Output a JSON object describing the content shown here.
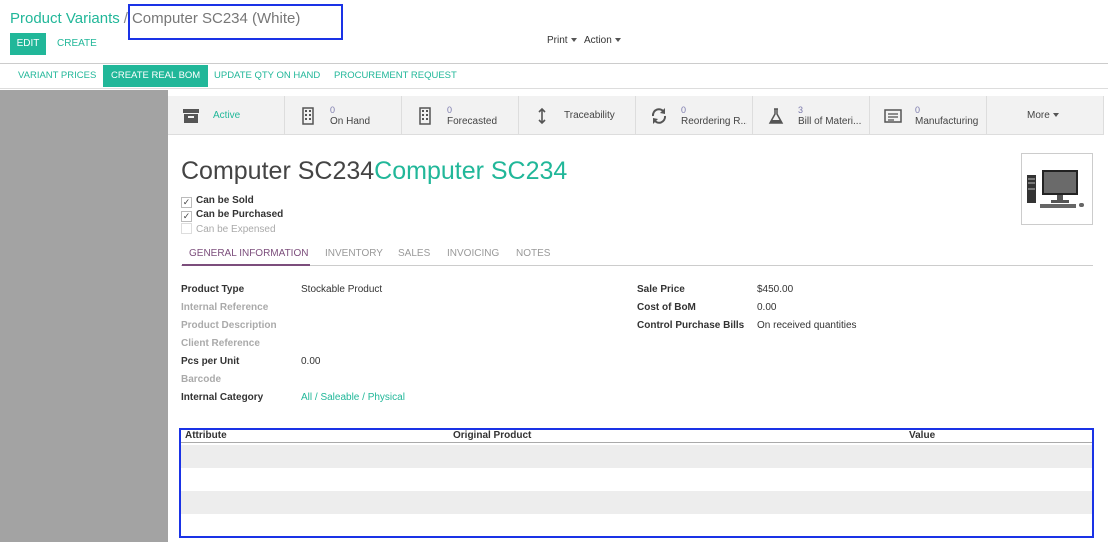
{
  "breadcrumb": {
    "parent": "Product Variants",
    "separator": "/",
    "current": "Computer SC234 (White)"
  },
  "controls": {
    "edit": "EDIT",
    "create": "CREATE",
    "print": "Print",
    "action": "Action"
  },
  "statusbar": {
    "variant_prices": "VARIANT PRICES",
    "create_real_bom": "CREATE REAL BOM",
    "update_qty": "UPDATE QTY ON HAND",
    "procurement": "PROCUREMENT REQUEST"
  },
  "smart_buttons": [
    {
      "icon": "archive-icon",
      "number": "",
      "label": "Active"
    },
    {
      "icon": "building-icon",
      "number": "0",
      "label": "On Hand"
    },
    {
      "icon": "building-icon",
      "number": "0",
      "label": "Forecasted"
    },
    {
      "icon": "arrows-vertical-icon",
      "number": "",
      "label": "Traceability"
    },
    {
      "icon": "refresh-icon",
      "number": "0",
      "label": "Reordering R..."
    },
    {
      "icon": "flask-icon",
      "number": "3",
      "label": "Bill of Materi..."
    },
    {
      "icon": "list-icon",
      "number": "0",
      "label": "Manufacturing"
    },
    {
      "icon": "",
      "number": "",
      "label": "More"
    }
  ],
  "product": {
    "name": "Computer SC234",
    "variant_name": "Computer SC234"
  },
  "checkboxes": [
    {
      "label": "Can be Sold",
      "checked": true
    },
    {
      "label": "Can be Purchased",
      "checked": true
    },
    {
      "label": "Can be Expensed",
      "checked": false
    }
  ],
  "tabs": [
    "GENERAL INFORMATION",
    "INVENTORY",
    "SALES",
    "INVOICING",
    "NOTES"
  ],
  "left_fields": [
    {
      "label": "Product Type",
      "value": "Stockable Product"
    },
    {
      "label": "Internal Reference",
      "value": ""
    },
    {
      "label": "Product Description",
      "value": ""
    },
    {
      "label": "Client Reference",
      "value": ""
    },
    {
      "label": "Pcs per Unit",
      "value": "0.00"
    },
    {
      "label": "Barcode",
      "value": ""
    },
    {
      "label": "Internal Category",
      "value": "All / Saleable / Physical"
    }
  ],
  "right_fields": [
    {
      "label": "Sale Price",
      "value": "$450.00"
    },
    {
      "label": "Cost of BoM",
      "value": "0.00"
    },
    {
      "label": "Control Purchase Bills",
      "value": "On received quantities"
    }
  ],
  "attribute_table": {
    "columns": [
      "Attribute",
      "Original Product",
      "Value"
    ]
  },
  "colors": {
    "accent": "#21b799",
    "secondary": "#7c7bad",
    "highlight": "#1a33e6"
  }
}
